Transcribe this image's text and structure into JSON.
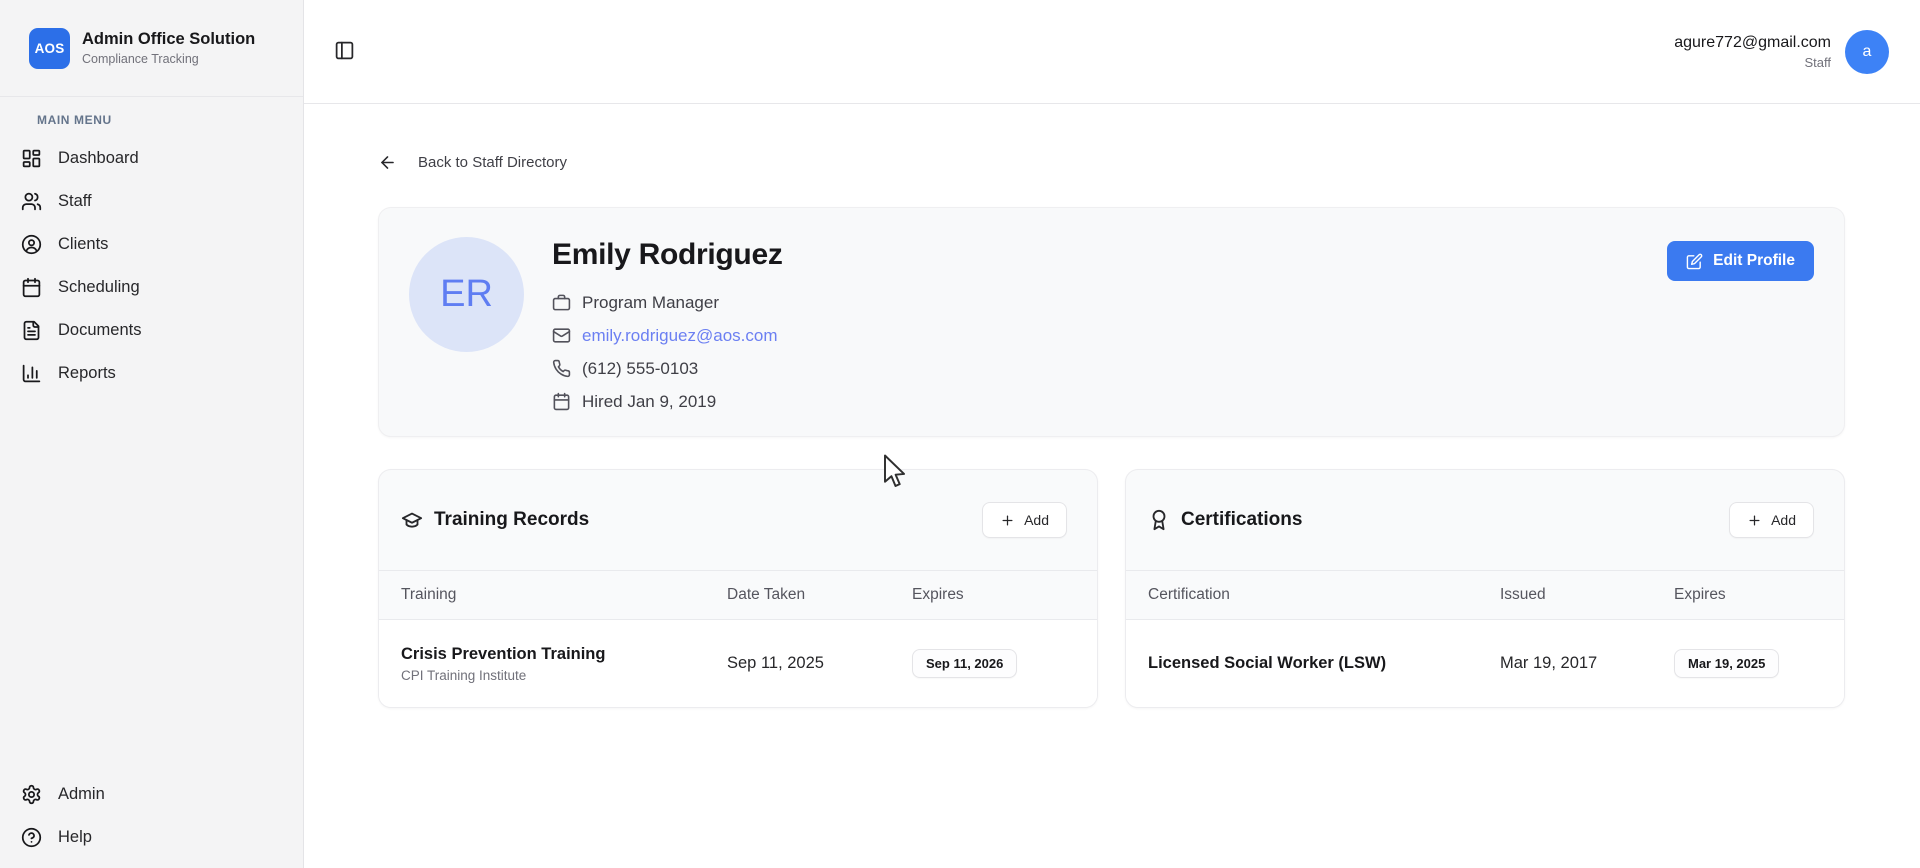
{
  "app": {
    "logo_text": "AOS",
    "name": "Admin Office Solution",
    "subtitle": "Compliance Tracking"
  },
  "topbar": {
    "account_email": "agure772@gmail.com",
    "account_role": "Staff",
    "avatar_letter": "a"
  },
  "sidebar": {
    "section_label": "MAIN MENU",
    "items": [
      {
        "label": "Dashboard",
        "icon": "dashboard-icon"
      },
      {
        "label": "Staff",
        "icon": "users-icon"
      },
      {
        "label": "Clients",
        "icon": "user-circle-icon"
      },
      {
        "label": "Scheduling",
        "icon": "calendar-icon"
      },
      {
        "label": "Documents",
        "icon": "file-text-icon"
      },
      {
        "label": "Reports",
        "icon": "bar-chart-icon"
      }
    ],
    "footer_items": [
      {
        "label": "Admin",
        "icon": "gear-icon"
      },
      {
        "label": "Help",
        "icon": "help-circle-icon"
      }
    ]
  },
  "page": {
    "back_link": "Back to Staff Directory",
    "profile": {
      "initials": "ER",
      "name": "Emily Rodriguez",
      "job_title": "Program Manager",
      "email": "emily.rodriguez@aos.com",
      "phone": "(612) 555-0103",
      "hired": "Hired Jan 9, 2019",
      "edit_button_label": "Edit Profile"
    },
    "training": {
      "title": "Training Records",
      "add_button_label": "Add",
      "columns": [
        "Training",
        "Date Taken",
        "Expires"
      ],
      "rows": [
        {
          "name": "Crisis Prevention Training",
          "provider": "CPI Training Institute",
          "date_taken": "Sep 11, 2025",
          "expires": "Sep 11, 2026"
        }
      ]
    },
    "certifications": {
      "title": "Certifications",
      "add_button_label": "Add",
      "columns": [
        "Certification",
        "Issued",
        "Expires"
      ],
      "rows": [
        {
          "name": "Licensed Social Worker (LSW)",
          "issued": "Mar 19, 2017",
          "expires": "Mar 19, 2025"
        }
      ]
    }
  },
  "colors": {
    "brand_blue": "#2c6fe8",
    "button_blue": "#3b7af0",
    "avatar_blue": "#3d82f6",
    "link_blue": "#6b7ff2",
    "profile_avatar_bg": "#dce4f8",
    "sidebar_bg": "#f4f4f5",
    "card_bg": "#f8f9fa",
    "border": "#e4e4e7"
  }
}
